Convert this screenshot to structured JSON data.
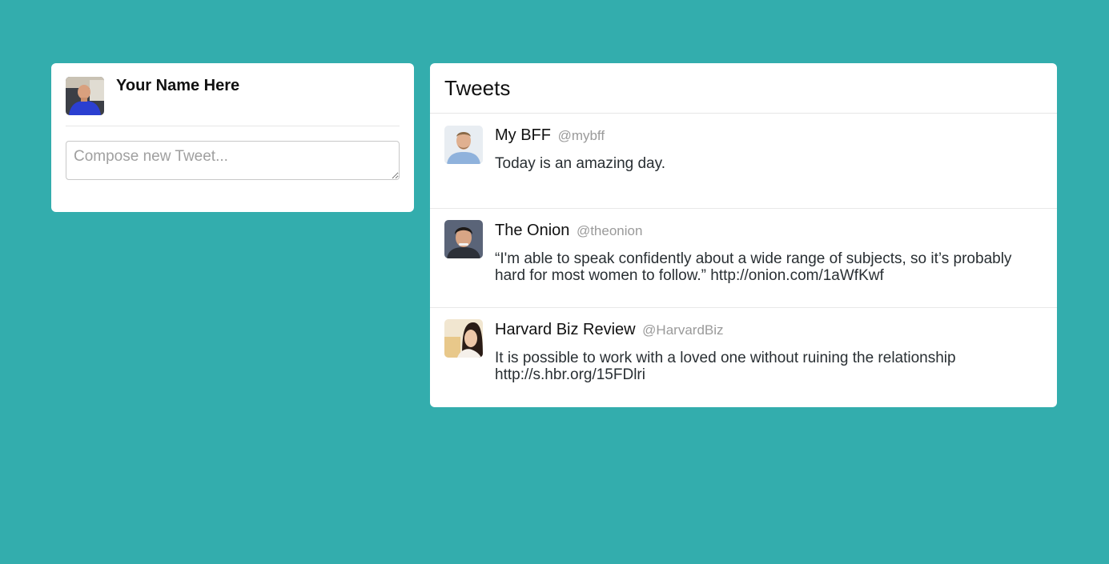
{
  "dashboard": {
    "user_name": "Your Name Here",
    "compose_placeholder": "Compose new Tweet..."
  },
  "stream": {
    "title": "Tweets",
    "tweets": [
      {
        "name": "My BFF",
        "handle": "@mybff",
        "text": "Today is an amazing day."
      },
      {
        "name": "The Onion",
        "handle": "@theonion",
        "text": "“I'm able to speak confidently about a wide range of subjects, so it’s probably hard for most women to follow.” http://onion.com/1aWfKwf"
      },
      {
        "name": "Harvard Biz Review",
        "handle": "@HarvardBiz",
        "text": "It is possible to work with a loved one without ruining the relationship http://s.hbr.org/15FDlri"
      }
    ]
  },
  "colors": {
    "background": "#33adad",
    "card": "#ffffff",
    "handle": "#9a9a9a"
  }
}
